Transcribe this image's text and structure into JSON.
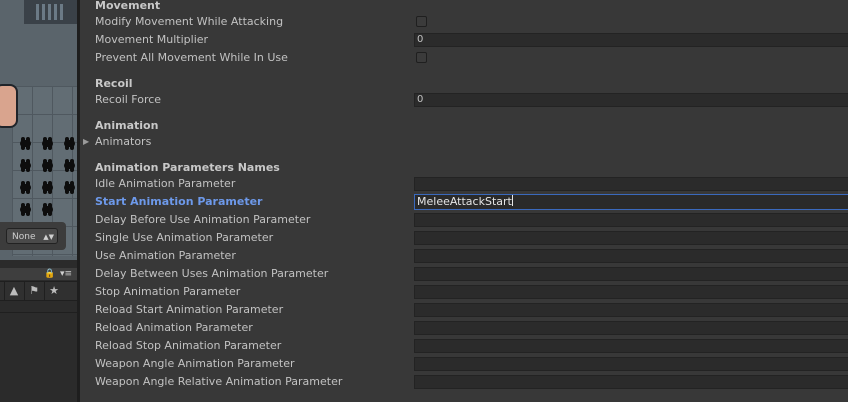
{
  "scene_panel": {
    "select_value": "None",
    "icons": [
      "lock-icon",
      "menu-icon",
      "shapes-icon",
      "tag-icon",
      "star-icon"
    ]
  },
  "sections": {
    "movement": {
      "header": "Movement",
      "modify_movement_label": "Modify Movement While Attacking",
      "modify_movement_checked": false,
      "multiplier_label": "Movement Multiplier",
      "multiplier_value": "0",
      "prevent_label": "Prevent All Movement While In Use",
      "prevent_checked": false
    },
    "recoil": {
      "header": "Recoil",
      "force_label": "Recoil Force",
      "force_value": "0"
    },
    "animation": {
      "header": "Animation",
      "animators_label": "Animators"
    },
    "parameters": {
      "header": "Animation Parameters Names",
      "items": [
        {
          "label": "Idle Animation Parameter",
          "value": ""
        },
        {
          "label": "Start Animation Parameter",
          "value": "MeleeAttackStart"
        },
        {
          "label": "Delay Before Use Animation Parameter",
          "value": ""
        },
        {
          "label": "Single Use Animation Parameter",
          "value": ""
        },
        {
          "label": "Use Animation Parameter",
          "value": ""
        },
        {
          "label": "Delay Between Uses Animation Parameter",
          "value": ""
        },
        {
          "label": "Stop Animation Parameter",
          "value": ""
        },
        {
          "label": "Reload Start Animation Parameter",
          "value": ""
        },
        {
          "label": "Reload Animation Parameter",
          "value": ""
        },
        {
          "label": "Reload Stop Animation Parameter",
          "value": ""
        },
        {
          "label": "Weapon Angle Animation Parameter",
          "value": ""
        },
        {
          "label": "Weapon Angle Relative Animation Parameter",
          "value": ""
        }
      ]
    }
  },
  "colors": {
    "background": "#383838",
    "active_label": "#6d99ea",
    "focus_border": "#3a69bd"
  }
}
